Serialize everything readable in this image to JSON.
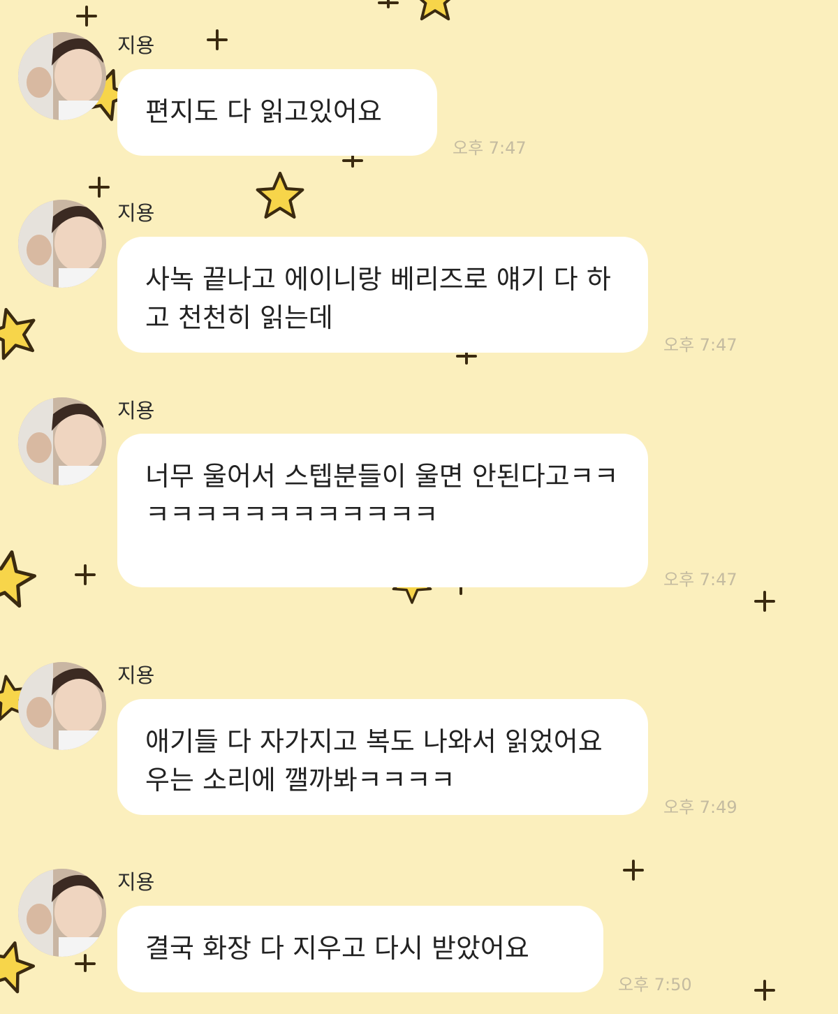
{
  "chat": {
    "messages": [
      {
        "sender": "지용",
        "text": "편지도 다 읽고있어요",
        "time": "오후 7:47"
      },
      {
        "sender": "지용",
        "text": "사녹 끝나고 에이니랑 베리즈로 얘기 다 하고 천천히 읽는데",
        "time": "오후 7:47"
      },
      {
        "sender": "지용",
        "text": "너무 울어서 스텝분들이 울면 안된다고ㅋㅋㅋㅋㅋㅋㅋㅋㅋㅋㅋㅋㅋㅋ",
        "time": "오후 7:47"
      },
      {
        "sender": "지용",
        "text": "애기들 다 자가지고 복도 나와서 읽었어요 우는 소리에 깰까봐ㅋㅋㅋㅋ",
        "time": "오후 7:49"
      },
      {
        "sender": "지용",
        "text": "결국 화장 다 지우고 다시 받았어요",
        "time": "오후 7:50"
      }
    ]
  },
  "theme": {
    "background": "#fbefbd",
    "bubble": "#ffffff",
    "star_fill": "#f7d54a",
    "star_stroke": "#3a2a10",
    "time_color": "#c4bba0"
  }
}
